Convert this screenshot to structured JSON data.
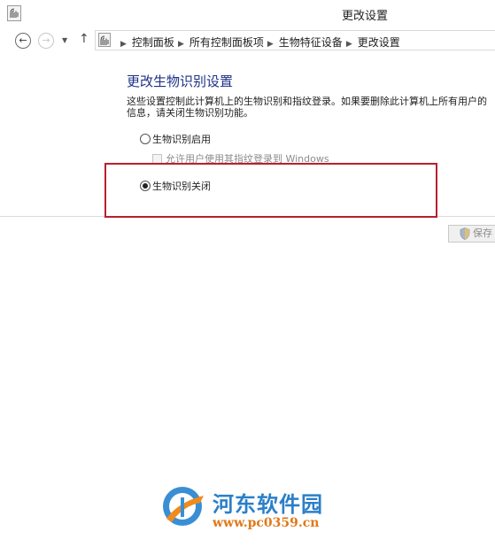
{
  "window": {
    "title": "更改设置"
  },
  "navigation": {
    "back_glyph": "←",
    "forward_glyph": "→",
    "dropdown_glyph": "▼",
    "up_glyph": "↑",
    "breadcrumbs": [
      "控制面板",
      "所有控制面板项",
      "生物特征设备",
      "更改设置"
    ]
  },
  "main": {
    "heading": "更改生物识别设置",
    "description_line1": "这些设置控制此计算机上的生物识别和指纹登录。如果要删除此计算机上所有用户的",
    "description_line2": "信息，请关闭生物识别功能。",
    "option_enable_label": "生物识别启用",
    "checkbox_label": "允许用户使用其指纹登录到 Windows",
    "option_disable_label": "生物识别关闭",
    "selected_option": "生物识别关闭"
  },
  "footer": {
    "save_label": "保存"
  },
  "watermark": {
    "title": "河东软件园",
    "url": "www.pc0359.cn"
  },
  "colors": {
    "heading": "#1e3287",
    "highlight_border": "#b8202c",
    "watermark_blue": "#2b7fc8",
    "watermark_orange": "#e0791a"
  },
  "icons": [
    "fingerprint-icon",
    "back-arrow-icon",
    "forward-arrow-icon",
    "chevron-down-icon",
    "up-arrow-icon",
    "breadcrumb-separator-icon",
    "shield-icon"
  ]
}
